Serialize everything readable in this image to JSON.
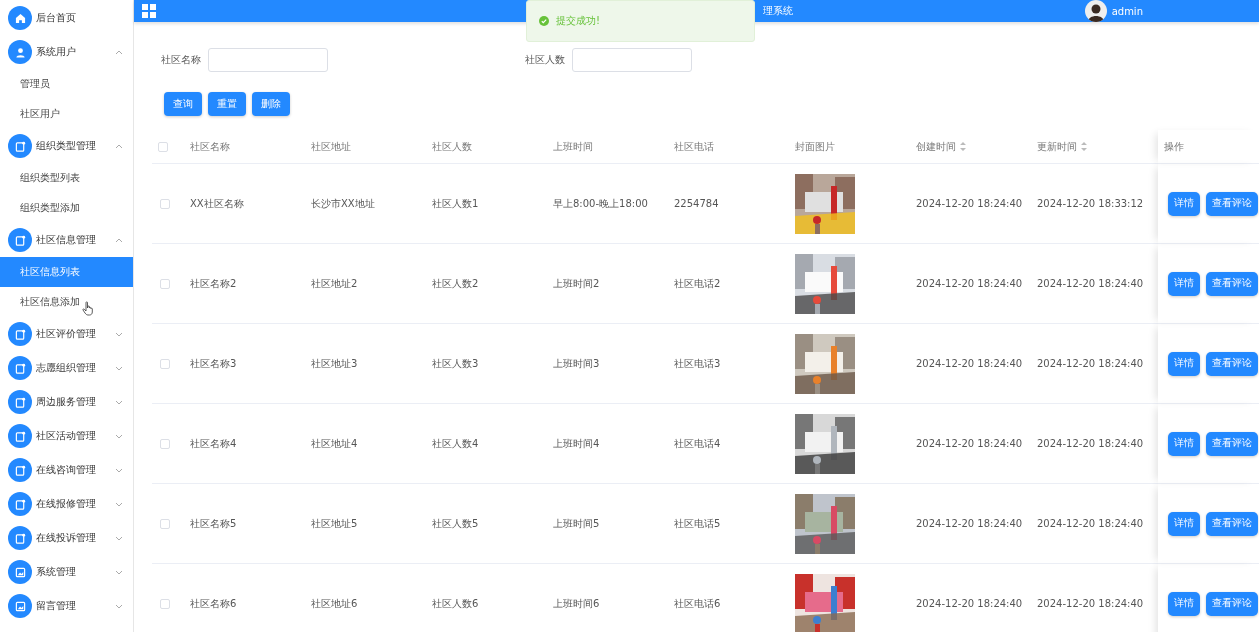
{
  "sidebar": {
    "items": [
      {
        "label": "后台首页",
        "kind": "home"
      },
      {
        "label": "系统用户",
        "kind": "user",
        "expanded": true,
        "children": [
          {
            "label": "管理员",
            "selected": false
          },
          {
            "label": "社区用户",
            "selected": false
          }
        ]
      },
      {
        "label": "组织类型管理",
        "kind": "module",
        "expanded": true,
        "children": [
          {
            "label": "组织类型列表",
            "selected": false
          },
          {
            "label": "组织类型添加",
            "selected": false
          }
        ]
      },
      {
        "label": "社区信息管理",
        "kind": "module",
        "expanded": true,
        "children": [
          {
            "label": "社区信息列表",
            "selected": true
          },
          {
            "label": "社区信息添加",
            "selected": false,
            "hovered": true
          }
        ]
      },
      {
        "label": "社区评价管理",
        "kind": "module",
        "expanded": false
      },
      {
        "label": "志愿组织管理",
        "kind": "module",
        "expanded": false
      },
      {
        "label": "周边服务管理",
        "kind": "module",
        "expanded": false
      },
      {
        "label": "社区活动管理",
        "kind": "module",
        "expanded": false
      },
      {
        "label": "在线咨询管理",
        "kind": "module",
        "expanded": false
      },
      {
        "label": "在线报修管理",
        "kind": "module",
        "expanded": false
      },
      {
        "label": "在线投诉管理",
        "kind": "module",
        "expanded": false
      },
      {
        "label": "系统管理",
        "kind": "media",
        "expanded": false
      },
      {
        "label": "留言管理",
        "kind": "media",
        "expanded": false
      }
    ]
  },
  "header": {
    "title": "理系统",
    "user": "admin"
  },
  "toast": {
    "message": "提交成功!"
  },
  "search": {
    "fields": [
      {
        "label": "社区名称"
      },
      {
        "label": "社区人数"
      }
    ],
    "buttons": [
      "查询",
      "重置",
      "删除"
    ]
  },
  "table": {
    "all_checked": false,
    "columns": [
      {
        "label": "社区名称",
        "sortable": false
      },
      {
        "label": "社区地址",
        "sortable": false
      },
      {
        "label": "社区人数",
        "sortable": false
      },
      {
        "label": "上班时间",
        "sortable": false
      },
      {
        "label": "社区电话",
        "sortable": false
      },
      {
        "label": "封面图片",
        "sortable": false
      },
      {
        "label": "创建时间",
        "sortable": true
      },
      {
        "label": "更新时间",
        "sortable": true
      },
      {
        "label": "操作",
        "sortable": false
      }
    ],
    "rows": [
      {
        "checked": false,
        "cells": [
          "XX社区名称",
          "长沙市XX地址",
          "社区人数1",
          "早上8:00-晚上18:00",
          "2254784"
        ],
        "created": "2024-12-20 18:24:40",
        "updated": "2024-12-20 18:33:12",
        "actions": [
          "详情",
          "查看评论"
        ]
      },
      {
        "checked": false,
        "cells": [
          "社区名称2",
          "社区地址2",
          "社区人数2",
          "上班时间2",
          "社区电话2"
        ],
        "created": "2024-12-20 18:24:40",
        "updated": "2024-12-20 18:24:40",
        "actions": [
          "详情",
          "查看评论"
        ]
      },
      {
        "checked": false,
        "cells": [
          "社区名称3",
          "社区地址3",
          "社区人数3",
          "上班时间3",
          "社区电话3"
        ],
        "created": "2024-12-20 18:24:40",
        "updated": "2024-12-20 18:24:40",
        "actions": [
          "详情",
          "查看评论"
        ]
      },
      {
        "checked": false,
        "cells": [
          "社区名称4",
          "社区地址4",
          "社区人数4",
          "上班时间4",
          "社区电话4"
        ],
        "created": "2024-12-20 18:24:40",
        "updated": "2024-12-20 18:24:40",
        "actions": [
          "详情",
          "查看评论"
        ]
      },
      {
        "checked": false,
        "cells": [
          "社区名称5",
          "社区地址5",
          "社区人数5",
          "上班时间5",
          "社区电话5"
        ],
        "created": "2024-12-20 18:24:40",
        "updated": "2024-12-20 18:24:40",
        "actions": [
          "详情",
          "查看评论"
        ]
      },
      {
        "checked": false,
        "cells": [
          "社区名称6",
          "社区地址6",
          "社区人数6",
          "上班时间6",
          "社区电话6"
        ],
        "created": "2024-12-20 18:24:40",
        "updated": "2024-12-20 18:24:40",
        "actions": [
          "详情",
          "查看评论"
        ]
      }
    ]
  }
}
